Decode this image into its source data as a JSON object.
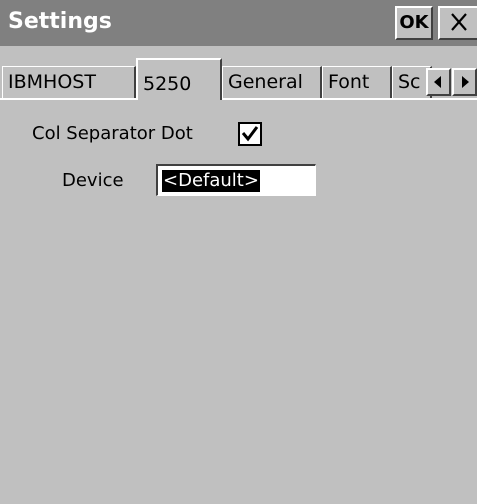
{
  "window": {
    "title": "Settings",
    "ok_label": "OK",
    "close_icon": "close-icon"
  },
  "tabs": [
    {
      "label": "IBMHOST",
      "active": false
    },
    {
      "label": "5250",
      "active": true
    },
    {
      "label": "General",
      "active": false
    },
    {
      "label": "Font",
      "active": false
    },
    {
      "label": "Sc",
      "active": false
    }
  ],
  "tab_scroll": {
    "left_icon": "arrow-left-icon",
    "right_icon": "arrow-right-icon"
  },
  "form": {
    "col_separator_label": "Col Separator Dot",
    "col_separator_checked": true,
    "device_label": "Device",
    "device_value": "<Default>"
  }
}
